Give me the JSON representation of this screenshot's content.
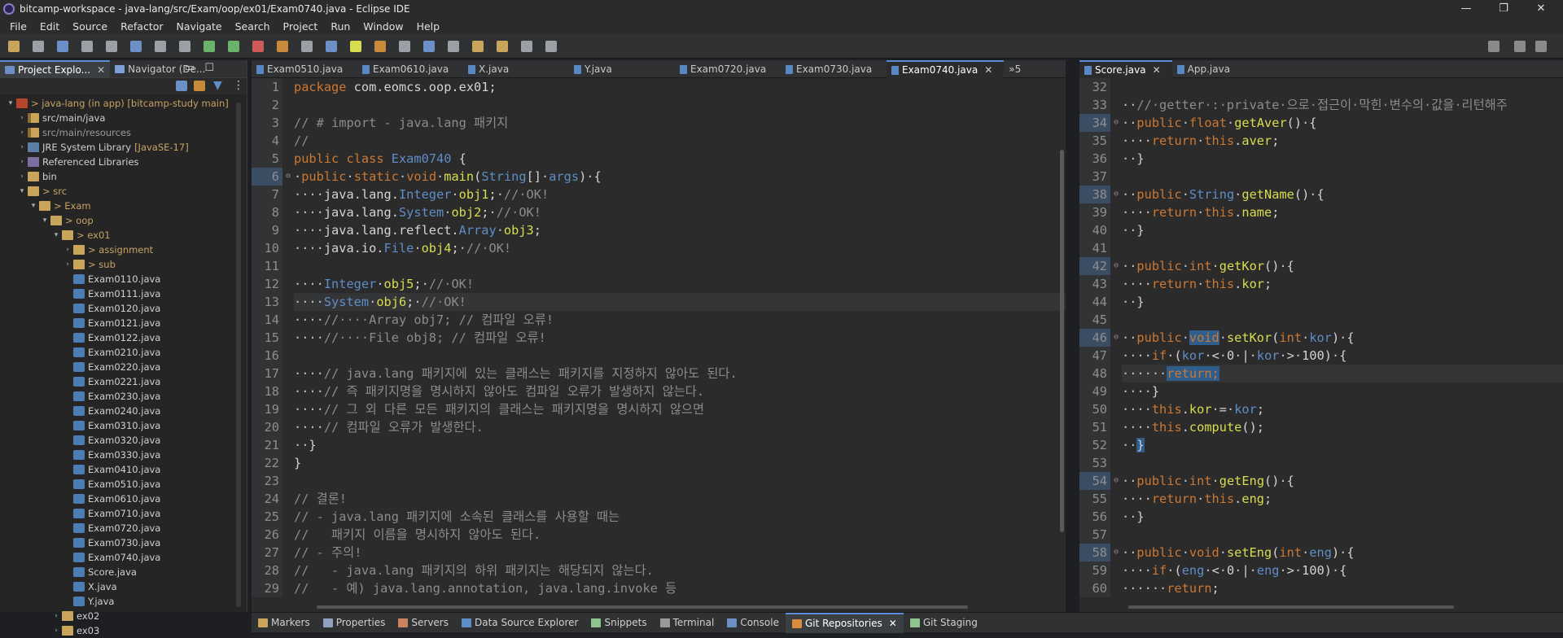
{
  "window": {
    "title": "bitcamp-workspace - java-lang/src/Exam/oop/ex01/Exam0740.java - Eclipse IDE",
    "minimize": "—",
    "maximize": "❐",
    "close": "✕"
  },
  "menu": [
    "File",
    "Edit",
    "Source",
    "Refactor",
    "Navigate",
    "Search",
    "Project",
    "Run",
    "Window",
    "Help"
  ],
  "left_panel": {
    "tabs": [
      {
        "label": "Project Explo..."
      },
      {
        "label": "Navigator (De..."
      }
    ],
    "tree": [
      {
        "depth": 0,
        "arrow": "▾",
        "icon": "proj",
        "label": "> java-lang (in app) [bitcamp-study main]",
        "style": "note"
      },
      {
        "depth": 1,
        "arrow": "›",
        "icon": "pkg",
        "label": "src/main/java",
        "style": ""
      },
      {
        "depth": 1,
        "arrow": "›",
        "icon": "pkg",
        "label": "src/main/resources",
        "style": "dim"
      },
      {
        "depth": 1,
        "arrow": "›",
        "icon": "jre",
        "label": "JRE System Library",
        "note": "[JavaSE-17]",
        "style": ""
      },
      {
        "depth": 1,
        "arrow": "›",
        "icon": "lib",
        "label": "Referenced Libraries",
        "style": ""
      },
      {
        "depth": 1,
        "arrow": "›",
        "icon": "folder",
        "label": "bin",
        "style": ""
      },
      {
        "depth": 1,
        "arrow": "▾",
        "icon": "folder",
        "label": "> src",
        "style": "note"
      },
      {
        "depth": 2,
        "arrow": "▾",
        "icon": "folder",
        "label": "> Exam",
        "style": "note"
      },
      {
        "depth": 3,
        "arrow": "▾",
        "icon": "folder",
        "label": "> oop",
        "style": "note"
      },
      {
        "depth": 4,
        "arrow": "▾",
        "icon": "folder",
        "label": "> ex01",
        "style": "note"
      },
      {
        "depth": 5,
        "arrow": "›",
        "icon": "folder",
        "label": "> assignment",
        "style": "note"
      },
      {
        "depth": 5,
        "arrow": "›",
        "icon": "folder",
        "label": "> sub",
        "style": "note"
      },
      {
        "depth": 5,
        "arrow": "",
        "icon": "java",
        "label": "Exam0110.java",
        "style": ""
      },
      {
        "depth": 5,
        "arrow": "",
        "icon": "java",
        "label": "Exam0111.java",
        "style": ""
      },
      {
        "depth": 5,
        "arrow": "",
        "icon": "java",
        "label": "Exam0120.java",
        "style": ""
      },
      {
        "depth": 5,
        "arrow": "",
        "icon": "java",
        "label": "Exam0121.java",
        "style": ""
      },
      {
        "depth": 5,
        "arrow": "",
        "icon": "java",
        "label": "Exam0122.java",
        "style": ""
      },
      {
        "depth": 5,
        "arrow": "",
        "icon": "java",
        "label": "Exam0210.java",
        "style": ""
      },
      {
        "depth": 5,
        "arrow": "",
        "icon": "java",
        "label": "Exam0220.java",
        "style": ""
      },
      {
        "depth": 5,
        "arrow": "",
        "icon": "java",
        "label": "Exam0221.java",
        "style": ""
      },
      {
        "depth": 5,
        "arrow": "",
        "icon": "java",
        "label": "Exam0230.java",
        "style": ""
      },
      {
        "depth": 5,
        "arrow": "",
        "icon": "java",
        "label": "Exam0240.java",
        "style": ""
      },
      {
        "depth": 5,
        "arrow": "",
        "icon": "java",
        "label": "Exam0310.java",
        "style": ""
      },
      {
        "depth": 5,
        "arrow": "",
        "icon": "java",
        "label": "Exam0320.java",
        "style": ""
      },
      {
        "depth": 5,
        "arrow": "",
        "icon": "java",
        "label": "Exam0330.java",
        "style": ""
      },
      {
        "depth": 5,
        "arrow": "",
        "icon": "java",
        "label": "Exam0410.java",
        "style": ""
      },
      {
        "depth": 5,
        "arrow": "",
        "icon": "java",
        "label": "Exam0510.java",
        "style": ""
      },
      {
        "depth": 5,
        "arrow": "",
        "icon": "java",
        "label": "Exam0610.java",
        "style": ""
      },
      {
        "depth": 5,
        "arrow": "",
        "icon": "java",
        "label": "Exam0710.java",
        "style": ""
      },
      {
        "depth": 5,
        "arrow": "",
        "icon": "java",
        "label": "Exam0720.java",
        "style": ""
      },
      {
        "depth": 5,
        "arrow": "",
        "icon": "java",
        "label": "Exam0730.java",
        "style": ""
      },
      {
        "depth": 5,
        "arrow": "",
        "icon": "java",
        "label": "Exam0740.java",
        "style": ""
      },
      {
        "depth": 5,
        "arrow": "",
        "icon": "java",
        "label": "Score.java",
        "style": ""
      },
      {
        "depth": 5,
        "arrow": "",
        "icon": "java",
        "label": "X.java",
        "style": ""
      },
      {
        "depth": 5,
        "arrow": "",
        "icon": "java",
        "label": "Y.java",
        "style": ""
      },
      {
        "depth": 4,
        "arrow": "›",
        "icon": "folder",
        "label": "ex02",
        "style": ""
      },
      {
        "depth": 4,
        "arrow": "›",
        "icon": "folder",
        "label": "ex03",
        "style": ""
      }
    ]
  },
  "editor": {
    "tabs": [
      {
        "label": "Exam0510.java",
        "active": false
      },
      {
        "label": "Exam0610.java",
        "active": false
      },
      {
        "label": "X.java",
        "active": false
      },
      {
        "label": "Y.java",
        "active": false
      },
      {
        "label": "Exam0720.java",
        "active": false
      },
      {
        "label": "Exam0730.java",
        "active": false
      },
      {
        "label": "Exam0740.java",
        "active": true
      }
    ],
    "overflow": "»5",
    "lines": [
      {
        "n": "1",
        "html": "<span class='k'>package</span> com.eomcs.oop.ex01;"
      },
      {
        "n": "2",
        "html": ""
      },
      {
        "n": "3",
        "html": "<span class='c'>// # import - java.lang 패키지</span>"
      },
      {
        "n": "4",
        "html": "<span class='c'>//</span>"
      },
      {
        "n": "5",
        "html": "<span class='k'>public</span> <span class='k'>class</span> <span class='t'>Exam0740</span> {"
      },
      {
        "n": "6",
        "fold": true,
        "html": "<span class='ps'>·</span><span class='k'>public</span><span class='ps'>·</span><span class='k'>static</span><span class='ps'>·</span><span class='k'>void</span><span class='ps'>·</span><span class='f'>main</span>(<span class='t'>String</span>[]<span class='ps'>·</span><span class='t'>args</span>)<span class='ps'>·</span>{"
      },
      {
        "n": "7",
        "html": "<span class='ps'>····</span>java.lang.<span class='t'>Integer</span><span class='ps'>·</span><span class='f'>obj1</span>;<span class='ps'>·</span><span class='c'>//·OK!</span>"
      },
      {
        "n": "8",
        "html": "<span class='ps'>····</span>java.lang.<span class='t'>System</span><span class='ps'>·</span><span class='f'>obj2</span>;<span class='ps'>·</span><span class='c'>//·OK!</span>"
      },
      {
        "n": "9",
        "html": "<span class='ps'>····</span>java.lang.reflect.<span class='t'>Array</span><span class='ps'>·</span><span class='f'>obj3</span>;"
      },
      {
        "n": "10",
        "html": "<span class='ps'>····</span>java.io.<span class='t'>File</span><span class='ps'>·</span><span class='f'>obj4</span>;<span class='ps'>·</span><span class='c'>//·OK!</span>"
      },
      {
        "n": "11",
        "html": ""
      },
      {
        "n": "12",
        "html": "<span class='ps'>····</span><span class='t'>Integer</span><span class='ps'>·</span><span class='f'>obj5</span>;<span class='ps'>·</span><span class='c'>//·OK!</span>"
      },
      {
        "n": "13",
        "cur": true,
        "html": "<span class='ps'>····</span><span class='t'>System</span><span class='ps'>·</span><span class='f'>obj6</span>;<span class='ps'>·</span><span class='c'>//·OK!</span>"
      },
      {
        "n": "14",
        "html": "<span class='ps'>····</span><span class='c'>//····Array obj7; // 컴파일 오류!</span>"
      },
      {
        "n": "15",
        "html": "<span class='ps'>····</span><span class='c'>//····File obj8; // 컴파일 오류!</span>"
      },
      {
        "n": "16",
        "html": ""
      },
      {
        "n": "17",
        "html": "<span class='ps'>····</span><span class='c'>// java.lang 패키지에 있는 클래스는 패키지를 지정하지 않아도 된다.</span>"
      },
      {
        "n": "18",
        "html": "<span class='ps'>····</span><span class='c'>// 즉 패키지명을 명시하지 않아도 컴파일 오류가 발생하지 않는다.</span>"
      },
      {
        "n": "19",
        "html": "<span class='ps'>····</span><span class='c'>// 그 외 다른 모든 패키지의 클래스는 패키지명을 명시하지 않으면</span>"
      },
      {
        "n": "20",
        "html": "<span class='ps'>····</span><span class='c'>// 컴파일 오류가 발생한다.</span>"
      },
      {
        "n": "21",
        "html": "<span class='ps'>··</span>}"
      },
      {
        "n": "22",
        "html": "}"
      },
      {
        "n": "23",
        "html": ""
      },
      {
        "n": "24",
        "html": "<span class='c'>// 결론!</span>"
      },
      {
        "n": "25",
        "html": "<span class='c'>// - java.lang 패키지에 소속된 클래스를 사용할 때는</span>"
      },
      {
        "n": "26",
        "html": "<span class='c'>//   패키지 이름을 명시하지 않아도 된다.</span>"
      },
      {
        "n": "27",
        "html": "<span class='c'>// - 주의!</span>"
      },
      {
        "n": "28",
        "html": "<span class='c'>//   - java.lang 패키지의 하위 패키지는 해당되지 않는다.</span>"
      },
      {
        "n": "29",
        "html": "<span class='c'>//   - 예) java.lang.annotation, java.lang.invoke 등</span>"
      }
    ]
  },
  "right_editor": {
    "tabs": [
      {
        "label": "Score.java",
        "active": true
      },
      {
        "label": "App.java",
        "active": false
      }
    ],
    "lines": [
      {
        "n": "32",
        "html": ""
      },
      {
        "n": "33",
        "html": "<span class='ps'>··</span><span class='c'>//·getter·:·private·으로·접근이·막힌·변수의·값을·리턴해주</span>"
      },
      {
        "n": "34",
        "fold": true,
        "html": "<span class='ps'>··</span><span class='k'>public</span><span class='ps'>·</span><span class='k'>float</span><span class='ps'>·</span><span class='f'>getAver</span>()<span class='ps'>·</span>{"
      },
      {
        "n": "35",
        "html": "<span class='ps'>····</span><span class='k'>return</span><span class='ps'>·</span><span class='k'>this</span>.<span class='f'>aver</span>;"
      },
      {
        "n": "36",
        "html": "<span class='ps'>··</span>}"
      },
      {
        "n": "37",
        "html": ""
      },
      {
        "n": "38",
        "fold": true,
        "html": "<span class='ps'>··</span><span class='k'>public</span><span class='ps'>·</span><span class='t'>String</span><span class='ps'>·</span><span class='f'>getName</span>()<span class='ps'>·</span>{"
      },
      {
        "n": "39",
        "html": "<span class='ps'>····</span><span class='k'>return</span><span class='ps'>·</span><span class='k'>this</span>.<span class='f'>name</span>;"
      },
      {
        "n": "40",
        "html": "<span class='ps'>··</span>}"
      },
      {
        "n": "41",
        "html": ""
      },
      {
        "n": "42",
        "fold": true,
        "html": "<span class='ps'>··</span><span class='k'>public</span><span class='ps'>·</span><span class='k'>int</span><span class='ps'>·</span><span class='f'>getKor</span>()<span class='ps'>·</span>{"
      },
      {
        "n": "43",
        "html": "<span class='ps'>····</span><span class='k'>return</span><span class='ps'>·</span><span class='k'>this</span>.<span class='f'>kor</span>;"
      },
      {
        "n": "44",
        "html": "<span class='ps'>··</span>}"
      },
      {
        "n": "45",
        "html": ""
      },
      {
        "n": "46",
        "fold": true,
        "html": "<span class='ps'>··</span><span class='k'>public</span><span class='ps'>·</span><span class='k sel'>void</span><span class='ps'>·</span><span class='f'>setKor</span>(<span class='k'>int</span><span class='ps'>·</span><span class='t'>kor</span>)<span class='ps'>·</span>{"
      },
      {
        "n": "47",
        "html": "<span class='ps'>····</span><span class='k'>if</span><span class='ps'>·</span>(<span class='t'>kor</span><span class='ps'>·</span>&lt;<span class='ps'>·</span>0<span class='ps'>·</span>|<span class='ps'>·</span><span class='t'>kor</span><span class='ps'>·</span>&gt;<span class='ps'>·</span>100)<span class='ps'>·</span>{"
      },
      {
        "n": "48",
        "cur": true,
        "html": "<span class='ps'>······</span><span class='k sel'>return;</span>"
      },
      {
        "n": "49",
        "html": "<span class='ps'>····</span>}"
      },
      {
        "n": "50",
        "html": "<span class='ps'>····</span><span class='k'>this</span>.<span class='f'>kor</span><span class='ps'>·</span>=<span class='ps'>·</span><span class='t'>kor</span>;"
      },
      {
        "n": "51",
        "html": "<span class='ps'>····</span><span class='k'>this</span>.<span class='f'>compute</span>();"
      },
      {
        "n": "52",
        "html": "<span class='ps'>··</span><span class='sel'>}</span>"
      },
      {
        "n": "53",
        "html": ""
      },
      {
        "n": "54",
        "fold": true,
        "html": "<span class='ps'>··</span><span class='k'>public</span><span class='ps'>·</span><span class='k'>int</span><span class='ps'>·</span><span class='f'>getEng</span>()<span class='ps'>·</span>{"
      },
      {
        "n": "55",
        "html": "<span class='ps'>····</span><span class='k'>return</span><span class='ps'>·</span><span class='k'>this</span>.<span class='f'>eng</span>;"
      },
      {
        "n": "56",
        "html": "<span class='ps'>··</span>}"
      },
      {
        "n": "57",
        "html": ""
      },
      {
        "n": "58",
        "fold": true,
        "html": "<span class='ps'>··</span><span class='k'>public</span><span class='ps'>·</span><span class='k'>void</span><span class='ps'>·</span><span class='f'>setEng</span>(<span class='k'>int</span><span class='ps'>·</span><span class='t'>eng</span>)<span class='ps'>·</span>{"
      },
      {
        "n": "59",
        "html": "<span class='ps'>····</span><span class='k'>if</span><span class='ps'>·</span>(<span class='t'>eng</span><span class='ps'>·</span>&lt;<span class='ps'>·</span>0<span class='ps'>·</span>|<span class='ps'>·</span><span class='t'>eng</span><span class='ps'>·</span>&gt;<span class='ps'>·</span>100)<span class='ps'>·</span>{"
      },
      {
        "n": "60",
        "html": "<span class='ps'>······</span><span class='k'>return</span>;"
      }
    ]
  },
  "bottom_tabs": [
    {
      "label": "Markers",
      "color": "#c9a45b",
      "active": false
    },
    {
      "label": "Properties",
      "color": "#8ea1c3",
      "active": false
    },
    {
      "label": "Servers",
      "color": "#c9845b",
      "active": false
    },
    {
      "label": "Data Source Explorer",
      "color": "#5f8dc7",
      "active": false
    },
    {
      "label": "Snippets",
      "color": "#8ec38e",
      "active": false
    },
    {
      "label": "Terminal",
      "color": "#9a9a9a",
      "active": false
    },
    {
      "label": "Console",
      "color": "#6b8fc7",
      "active": false
    },
    {
      "label": "Git Repositories",
      "color": "#d88c3c",
      "active": true
    },
    {
      "label": "Git Staging",
      "color": "#8ec38e",
      "active": false
    }
  ],
  "colors": {
    "accent": "#5a8dd8",
    "keyword": "#cc7832",
    "type": "#5f8dc7",
    "field": "#d8dd4f",
    "comment": "#8c8c8c"
  }
}
